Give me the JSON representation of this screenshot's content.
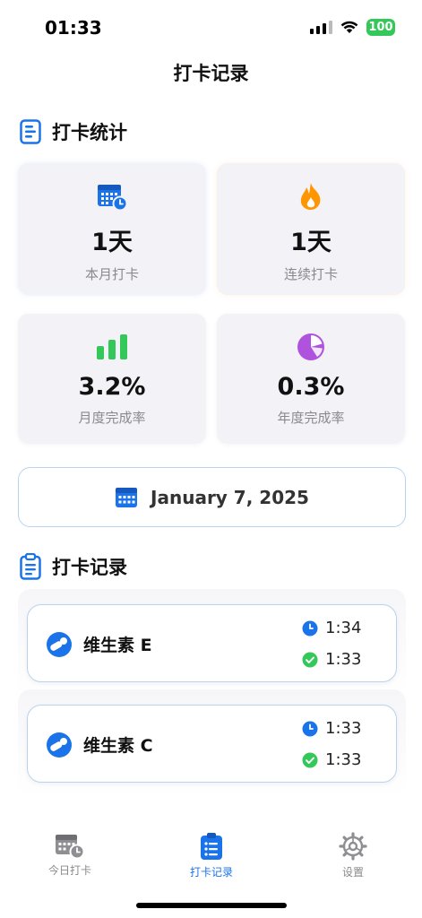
{
  "status_bar": {
    "time": "01:33",
    "battery": "100"
  },
  "header": {
    "title": "打卡记录"
  },
  "stats_section": {
    "title": "打卡统计"
  },
  "stats": [
    {
      "icon": "calendar-clock-icon",
      "value": "1天",
      "label": "本月打卡",
      "color": "#1a73e8"
    },
    {
      "icon": "flame-icon",
      "value": "1天",
      "label": "连续打卡",
      "color": "#ff9500"
    },
    {
      "icon": "bar-chart-icon",
      "value": "3.2%",
      "label": "月度完成率",
      "color": "#34c759"
    },
    {
      "icon": "pie-chart-icon",
      "value": "0.3%",
      "label": "年度完成率",
      "color": "#af52de"
    }
  ],
  "date_selector": {
    "icon": "calendar-icon",
    "date": "January 7, 2025"
  },
  "records_section": {
    "title": "打卡记录"
  },
  "records": [
    {
      "name": "维生素 E",
      "scheduled_time": "1:34",
      "checked_time": "1:33"
    },
    {
      "name": "维生素 C",
      "scheduled_time": "1:33",
      "checked_time": "1:33"
    }
  ],
  "tabs": [
    {
      "label": "今日打卡",
      "icon": "calendar-clock-icon",
      "active": false
    },
    {
      "label": "打卡记录",
      "icon": "clipboard-list-icon",
      "active": true
    },
    {
      "label": "设置",
      "icon": "gear-icon",
      "active": false
    }
  ],
  "colors": {
    "accent": "#1a73e8",
    "success": "#34c759",
    "card_bg": "#f3f2f7",
    "secondary_text": "#8a8a8e"
  }
}
